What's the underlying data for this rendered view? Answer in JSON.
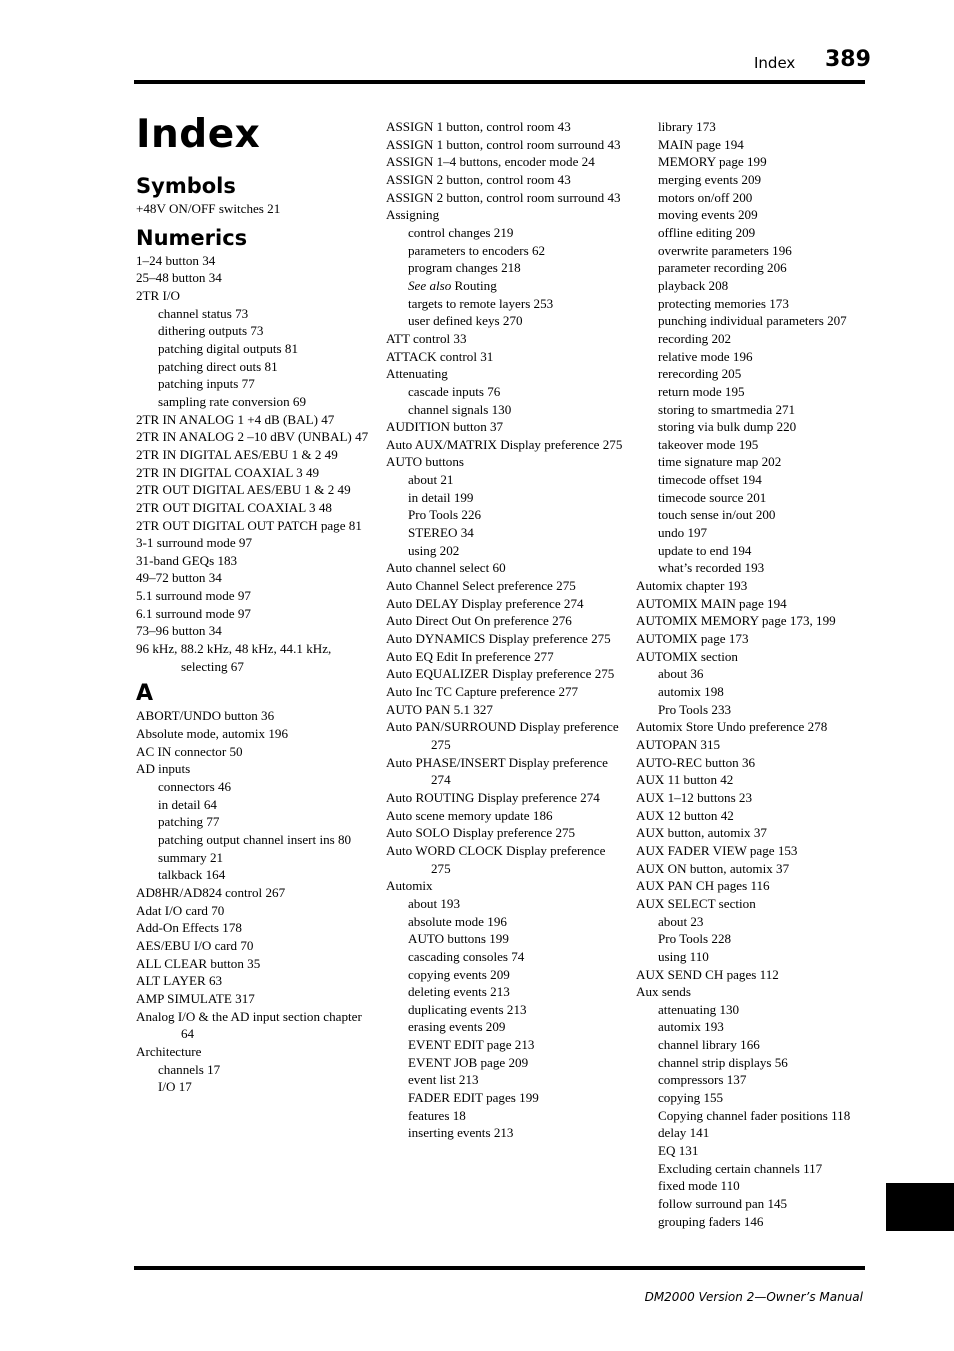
{
  "header": {
    "section_label": "Index",
    "page_number": "389"
  },
  "footer": {
    "manual_title": "DM2000 Version 2—Owner’s Manual"
  },
  "page_title": "Index",
  "columns": [
    {
      "blocks": [
        {
          "type": "section",
          "text": "Symbols",
          "first": true
        },
        {
          "type": "entry",
          "level": 0,
          "text": "+48V ON/OFF switches 21"
        },
        {
          "type": "section",
          "text": "Numerics"
        },
        {
          "type": "entry",
          "level": 0,
          "text": "1–24 button 34"
        },
        {
          "type": "entry",
          "level": 0,
          "text": "25–48 button 34"
        },
        {
          "type": "entry",
          "level": 0,
          "text": "2TR I/O"
        },
        {
          "type": "entry",
          "level": 1,
          "text": "channel status 73"
        },
        {
          "type": "entry",
          "level": 1,
          "text": "dithering outputs 73"
        },
        {
          "type": "entry",
          "level": 1,
          "text": "patching digital outputs 81"
        },
        {
          "type": "entry",
          "level": 1,
          "text": "patching direct outs 81"
        },
        {
          "type": "entry",
          "level": 1,
          "text": "patching inputs 77"
        },
        {
          "type": "entry",
          "level": 1,
          "text": "sampling rate conversion 69"
        },
        {
          "type": "entry",
          "level": 0,
          "text": "2TR IN ANALOG 1 +4 dB (BAL) 47"
        },
        {
          "type": "entry",
          "level": 0,
          "text": "2TR IN ANALOG 2 –10 dBV (UNBAL) 47"
        },
        {
          "type": "entry",
          "level": 0,
          "text": "2TR IN DIGITAL AES/EBU 1 & 2 49"
        },
        {
          "type": "entry",
          "level": 0,
          "text": "2TR IN DIGITAL COAXIAL 3 49"
        },
        {
          "type": "entry",
          "level": 0,
          "text": "2TR OUT DIGITAL AES/EBU 1 & 2 49"
        },
        {
          "type": "entry",
          "level": 0,
          "text": "2TR OUT DIGITAL COAXIAL 3 48"
        },
        {
          "type": "entry",
          "level": 0,
          "text": "2TR OUT DIGITAL OUT PATCH page 81"
        },
        {
          "type": "entry",
          "level": 0,
          "text": "3-1 surround mode 97"
        },
        {
          "type": "entry",
          "level": 0,
          "text": "31-band GEQs 183"
        },
        {
          "type": "entry",
          "level": 0,
          "text": "49–72 button 34"
        },
        {
          "type": "entry",
          "level": 0,
          "text": "5.1 surround mode 97"
        },
        {
          "type": "entry",
          "level": 0,
          "text": "6.1 surround mode 97"
        },
        {
          "type": "entry",
          "level": 0,
          "text": "73–96 button 34"
        },
        {
          "type": "entry",
          "level": 0,
          "text": "96 kHz, 88.2 kHz, 48 kHz, 44.1 kHz, selecting 67"
        },
        {
          "type": "letter",
          "text": "A"
        },
        {
          "type": "entry",
          "level": 0,
          "text": "ABORT/UNDO button 36"
        },
        {
          "type": "entry",
          "level": 0,
          "text": "Absolute mode, automix 196"
        },
        {
          "type": "entry",
          "level": 0,
          "text": "AC IN connector 50"
        },
        {
          "type": "entry",
          "level": 0,
          "text": "AD inputs"
        },
        {
          "type": "entry",
          "level": 1,
          "text": "connectors 46"
        },
        {
          "type": "entry",
          "level": 1,
          "text": "in detail 64"
        },
        {
          "type": "entry",
          "level": 1,
          "text": "patching 77"
        },
        {
          "type": "entry",
          "level": 1,
          "text": "patching output channel insert ins 80"
        },
        {
          "type": "entry",
          "level": 1,
          "text": "summary 21"
        },
        {
          "type": "entry",
          "level": 1,
          "text": "talkback 164"
        },
        {
          "type": "entry",
          "level": 0,
          "text": "AD8HR/AD824 control 267"
        },
        {
          "type": "entry",
          "level": 0,
          "text": "Adat I/O card 70"
        },
        {
          "type": "entry",
          "level": 0,
          "text": "Add-On Effects 178"
        },
        {
          "type": "entry",
          "level": 0,
          "text": "AES/EBU I/O card 70"
        },
        {
          "type": "entry",
          "level": 0,
          "text": "ALL CLEAR button 35"
        },
        {
          "type": "entry",
          "level": 0,
          "text": "ALT LAYER 63"
        },
        {
          "type": "entry",
          "level": 0,
          "text": "AMP SIMULATE 317"
        },
        {
          "type": "entry",
          "level": 0,
          "text": "Analog I/O & the AD input section chapter 64"
        },
        {
          "type": "entry",
          "level": 0,
          "text": "Architecture"
        },
        {
          "type": "entry",
          "level": 1,
          "text": "channels 17"
        },
        {
          "type": "entry",
          "level": 1,
          "text": "I/O 17"
        }
      ]
    },
    {
      "blocks": [
        {
          "type": "entry",
          "level": 0,
          "text": "ASSIGN 1 button, control room 43"
        },
        {
          "type": "entry",
          "level": 0,
          "text": "ASSIGN 1 button, control room surround 43"
        },
        {
          "type": "entry",
          "level": 0,
          "text": "ASSIGN 1–4 buttons, encoder mode 24"
        },
        {
          "type": "entry",
          "level": 0,
          "text": "ASSIGN 2 button, control room 43"
        },
        {
          "type": "entry",
          "level": 0,
          "text": "ASSIGN 2 button, control room surround 43"
        },
        {
          "type": "entry",
          "level": 0,
          "text": "Assigning"
        },
        {
          "type": "entry",
          "level": 1,
          "text": "control changes 219"
        },
        {
          "type": "entry",
          "level": 1,
          "text": "parameters to encoders 62"
        },
        {
          "type": "entry",
          "level": 1,
          "text": "program changes 218"
        },
        {
          "type": "entry",
          "level": 1,
          "italic_prefix": "See also",
          "text": " Routing"
        },
        {
          "type": "entry",
          "level": 1,
          "text": "targets to remote layers 253"
        },
        {
          "type": "entry",
          "level": 1,
          "text": "user defined keys 270"
        },
        {
          "type": "entry",
          "level": 0,
          "text": "ATT control 33"
        },
        {
          "type": "entry",
          "level": 0,
          "text": "ATTACK control 31"
        },
        {
          "type": "entry",
          "level": 0,
          "text": "Attenuating"
        },
        {
          "type": "entry",
          "level": 1,
          "text": "cascade inputs 76"
        },
        {
          "type": "entry",
          "level": 1,
          "text": "channel signals 130"
        },
        {
          "type": "entry",
          "level": 0,
          "text": "AUDITION button 37"
        },
        {
          "type": "entry",
          "level": 0,
          "text": "Auto AUX/MATRIX Display preference 275"
        },
        {
          "type": "entry",
          "level": 0,
          "text": "AUTO buttons"
        },
        {
          "type": "entry",
          "level": 1,
          "text": "about 21"
        },
        {
          "type": "entry",
          "level": 1,
          "text": "in detail 199"
        },
        {
          "type": "entry",
          "level": 1,
          "text": "Pro Tools 226"
        },
        {
          "type": "entry",
          "level": 1,
          "text": "STEREO 34"
        },
        {
          "type": "entry",
          "level": 1,
          "text": "using 202"
        },
        {
          "type": "entry",
          "level": 0,
          "text": "Auto channel select 60"
        },
        {
          "type": "entry",
          "level": 0,
          "text": "Auto Channel Select preference 275"
        },
        {
          "type": "entry",
          "level": 0,
          "text": "Auto DELAY Display preference 274"
        },
        {
          "type": "entry",
          "level": 0,
          "text": "Auto Direct Out On preference 276"
        },
        {
          "type": "entry",
          "level": 0,
          "text": "Auto DYNAMICS Display preference 275"
        },
        {
          "type": "entry",
          "level": 0,
          "text": "Auto EQ Edit In preference 277"
        },
        {
          "type": "entry",
          "level": 0,
          "text": "Auto EQUALIZER Display preference 275"
        },
        {
          "type": "entry",
          "level": 0,
          "text": "Auto Inc TC Capture preference 277"
        },
        {
          "type": "entry",
          "level": 0,
          "text": "AUTO PAN 5.1 327"
        },
        {
          "type": "entry",
          "level": 0,
          "text": "Auto PAN/SURROUND Display preference 275"
        },
        {
          "type": "entry",
          "level": 0,
          "text": "Auto PHASE/INSERT Display preference 274"
        },
        {
          "type": "entry",
          "level": 0,
          "text": "Auto ROUTING Display preference 274"
        },
        {
          "type": "entry",
          "level": 0,
          "text": "Auto scene memory update 186"
        },
        {
          "type": "entry",
          "level": 0,
          "text": "Auto SOLO Display preference 275"
        },
        {
          "type": "entry",
          "level": 0,
          "text": "Auto WORD CLOCK Display preference 275"
        },
        {
          "type": "entry",
          "level": 0,
          "text": "Automix"
        },
        {
          "type": "entry",
          "level": 1,
          "text": "about 193"
        },
        {
          "type": "entry",
          "level": 1,
          "text": "absolute mode 196"
        },
        {
          "type": "entry",
          "level": 1,
          "text": "AUTO buttons 199"
        },
        {
          "type": "entry",
          "level": 1,
          "text": "cascading consoles 74"
        },
        {
          "type": "entry",
          "level": 1,
          "text": "copying events 209"
        },
        {
          "type": "entry",
          "level": 1,
          "text": "deleting events 213"
        },
        {
          "type": "entry",
          "level": 1,
          "text": "duplicating events 213"
        },
        {
          "type": "entry",
          "level": 1,
          "text": "erasing events 209"
        },
        {
          "type": "entry",
          "level": 1,
          "text": "EVENT EDIT page 213"
        },
        {
          "type": "entry",
          "level": 1,
          "text": "EVENT JOB page 209"
        },
        {
          "type": "entry",
          "level": 1,
          "text": "event list 213"
        },
        {
          "type": "entry",
          "level": 1,
          "text": "FADER EDIT pages 199"
        },
        {
          "type": "entry",
          "level": 1,
          "text": "features 18"
        },
        {
          "type": "entry",
          "level": 1,
          "text": "inserting events 213"
        }
      ]
    },
    {
      "blocks": [
        {
          "type": "entry",
          "level": 1,
          "text": "library 173"
        },
        {
          "type": "entry",
          "level": 1,
          "text": "MAIN page 194"
        },
        {
          "type": "entry",
          "level": 1,
          "text": "MEMORY page 199"
        },
        {
          "type": "entry",
          "level": 1,
          "text": "merging events 209"
        },
        {
          "type": "entry",
          "level": 1,
          "text": "motors on/off 200"
        },
        {
          "type": "entry",
          "level": 1,
          "text": "moving events 209"
        },
        {
          "type": "entry",
          "level": 1,
          "text": "offline editing 209"
        },
        {
          "type": "entry",
          "level": 1,
          "text": "overwrite parameters 196"
        },
        {
          "type": "entry",
          "level": 1,
          "text": "parameter recording 206"
        },
        {
          "type": "entry",
          "level": 1,
          "text": "playback 208"
        },
        {
          "type": "entry",
          "level": 1,
          "text": "protecting memories 173"
        },
        {
          "type": "entry",
          "level": 1,
          "text": "punching individual parameters 207"
        },
        {
          "type": "entry",
          "level": 1,
          "text": "recording 202"
        },
        {
          "type": "entry",
          "level": 1,
          "text": "relative mode 196"
        },
        {
          "type": "entry",
          "level": 1,
          "text": "rerecording 205"
        },
        {
          "type": "entry",
          "level": 1,
          "text": "return mode 195"
        },
        {
          "type": "entry",
          "level": 1,
          "text": "storing to smartmedia 271"
        },
        {
          "type": "entry",
          "level": 1,
          "text": "storing via bulk dump 220"
        },
        {
          "type": "entry",
          "level": 1,
          "text": "takeover mode 195"
        },
        {
          "type": "entry",
          "level": 1,
          "text": "time signature map 202"
        },
        {
          "type": "entry",
          "level": 1,
          "text": "timecode offset 194"
        },
        {
          "type": "entry",
          "level": 1,
          "text": "timecode source 201"
        },
        {
          "type": "entry",
          "level": 1,
          "text": "touch sense in/out 200"
        },
        {
          "type": "entry",
          "level": 1,
          "text": "undo 197"
        },
        {
          "type": "entry",
          "level": 1,
          "text": "update to end 194"
        },
        {
          "type": "entry",
          "level": 1,
          "text": "what’s recorded 193"
        },
        {
          "type": "entry",
          "level": 0,
          "text": "Automix chapter 193"
        },
        {
          "type": "entry",
          "level": 0,
          "text": "AUTOMIX MAIN page 194"
        },
        {
          "type": "entry",
          "level": 0,
          "text": "AUTOMIX MEMORY page 173, 199"
        },
        {
          "type": "entry",
          "level": 0,
          "text": "AUTOMIX page 173"
        },
        {
          "type": "entry",
          "level": 0,
          "text": "AUTOMIX section"
        },
        {
          "type": "entry",
          "level": 1,
          "text": "about 36"
        },
        {
          "type": "entry",
          "level": 1,
          "text": "automix 198"
        },
        {
          "type": "entry",
          "level": 1,
          "text": "Pro Tools 233"
        },
        {
          "type": "entry",
          "level": 0,
          "text": "Automix Store Undo preference 278"
        },
        {
          "type": "entry",
          "level": 0,
          "text": "AUTOPAN 315"
        },
        {
          "type": "entry",
          "level": 0,
          "text": "AUTO-REC button 36"
        },
        {
          "type": "entry",
          "level": 0,
          "text": "AUX 11 button 42"
        },
        {
          "type": "entry",
          "level": 0,
          "text": "AUX 1–12 buttons 23"
        },
        {
          "type": "entry",
          "level": 0,
          "text": "AUX 12 button 42"
        },
        {
          "type": "entry",
          "level": 0,
          "text": "AUX button, automix 37"
        },
        {
          "type": "entry",
          "level": 0,
          "text": "AUX FADER VIEW page 153"
        },
        {
          "type": "entry",
          "level": 0,
          "text": "AUX ON button, automix 37"
        },
        {
          "type": "entry",
          "level": 0,
          "text": "AUX PAN CH pages 116"
        },
        {
          "type": "entry",
          "level": 0,
          "text": "AUX SELECT section"
        },
        {
          "type": "entry",
          "level": 1,
          "text": "about 23"
        },
        {
          "type": "entry",
          "level": 1,
          "text": "Pro Tools 228"
        },
        {
          "type": "entry",
          "level": 1,
          "text": "using 110"
        },
        {
          "type": "entry",
          "level": 0,
          "text": "AUX SEND CH pages 112"
        },
        {
          "type": "entry",
          "level": 0,
          "text": "Aux sends"
        },
        {
          "type": "entry",
          "level": 1,
          "text": "attenuating 130"
        },
        {
          "type": "entry",
          "level": 1,
          "text": "automix 193"
        },
        {
          "type": "entry",
          "level": 1,
          "text": "channel library 166"
        },
        {
          "type": "entry",
          "level": 1,
          "text": "channel strip displays 56"
        },
        {
          "type": "entry",
          "level": 1,
          "text": "compressors 137"
        },
        {
          "type": "entry",
          "level": 1,
          "text": "copying 155"
        },
        {
          "type": "entry",
          "level": 1,
          "text": "Copying channel fader positions 118"
        },
        {
          "type": "entry",
          "level": 1,
          "text": "delay 141"
        },
        {
          "type": "entry",
          "level": 1,
          "text": "EQ 131"
        },
        {
          "type": "entry",
          "level": 1,
          "text": "Excluding certain channels 117"
        },
        {
          "type": "entry",
          "level": 1,
          "text": "fixed mode 110"
        },
        {
          "type": "entry",
          "level": 1,
          "text": "follow surround pan 145"
        },
        {
          "type": "entry",
          "level": 1,
          "text": "grouping faders 146"
        }
      ]
    }
  ]
}
